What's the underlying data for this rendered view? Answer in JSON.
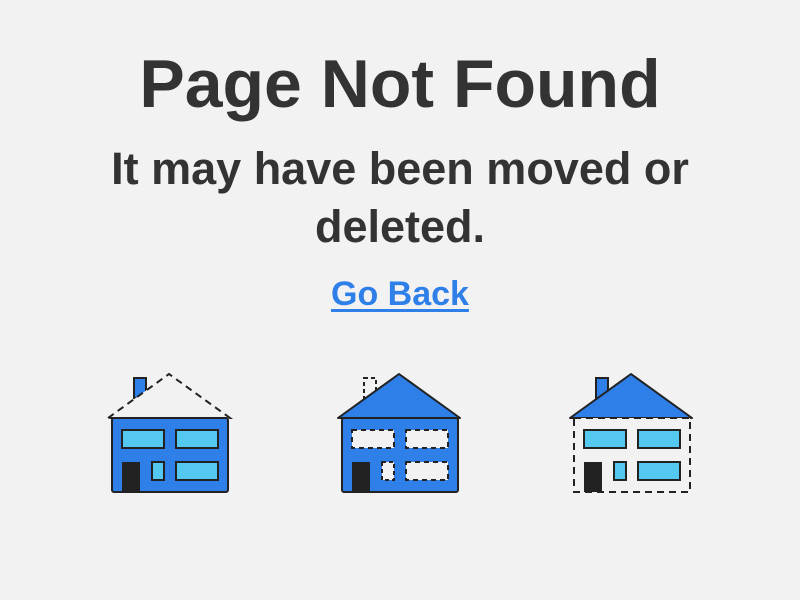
{
  "page": {
    "title": "Page Not Found",
    "subtitle": "It may have been moved or deleted.",
    "back_link": "Go Back"
  },
  "illustration": {
    "houses": [
      {
        "icon": "house-missing-roof-icon"
      },
      {
        "icon": "house-missing-windows-icon"
      },
      {
        "icon": "house-missing-walls-icon"
      }
    ]
  },
  "colors": {
    "background": "#f2f2f2",
    "text": "#333333",
    "link": "#2f7fe8",
    "house_blue": "#2f7fe8",
    "window_blue": "#55c8f2",
    "door": "#222222"
  }
}
